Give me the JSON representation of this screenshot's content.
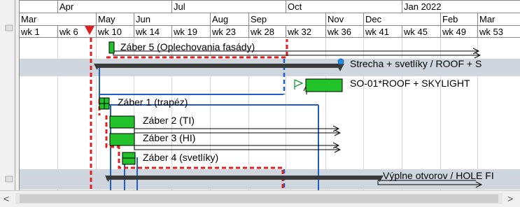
{
  "header": {
    "year_row": [
      "Apr",
      "Jul",
      "Oct",
      "Jan 2022"
    ],
    "month_row": [
      "Mar",
      "May",
      "Jun",
      "Aug",
      "Sep",
      "Nov",
      "Dec",
      "Feb",
      "Mar"
    ],
    "week_row": [
      "wk 1",
      "wk 6",
      "wk 10",
      "wk 14",
      "wk 19",
      "wk 23",
      "wk 28",
      "wk 32",
      "wk 36",
      "wk 41",
      "wk 45",
      "wk 49",
      "wk 53"
    ]
  },
  "tasks": [
    {
      "label": "Záber 5 (Oplechovania fasády)"
    },
    {
      "label": "Strecha + svetlíky / ROOF + S"
    },
    {
      "label": "SO-01*ROOF + SKYLIGHT"
    },
    {
      "label": "Záber 1 (trapéz)"
    },
    {
      "label": "Záber 2 (TI)"
    },
    {
      "label": "Záber 3 (HI)"
    },
    {
      "label": "Záber 4 (svetlíky)"
    },
    {
      "label": "Výplne otvorov / HOLE FI"
    }
  ],
  "scrollbar": {
    "left_arrow": "<",
    "right_arrow": ">"
  },
  "colors": {
    "task_bar": "#22c22a",
    "summary_bar": "#3a3a3a",
    "summary_band": "#cfd6de",
    "critical_path": "#e02020",
    "link_line": "#1f5fc8",
    "today_marker": "#e02020"
  }
}
